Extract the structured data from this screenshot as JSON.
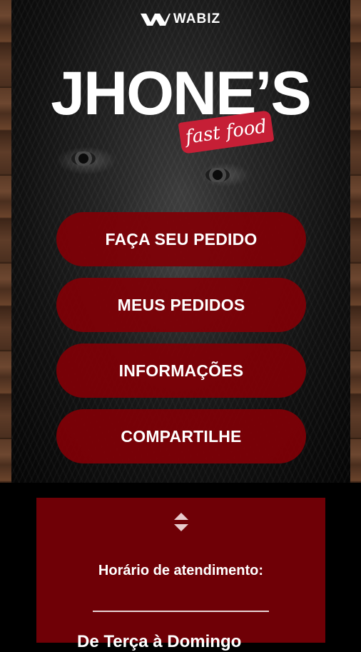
{
  "logo": {
    "text": "WABIZ",
    "icon": "wabiz-logo-icon"
  },
  "brand": {
    "title": "JHONE’S",
    "tagline": "fast food"
  },
  "menu": {
    "items": [
      {
        "label": "FAÇA SEU PEDIDO"
      },
      {
        "label": "MEUS PEDIDOS"
      },
      {
        "label": "INFORMAÇÕES"
      },
      {
        "label": "COMPARTILHE"
      }
    ]
  },
  "hours": {
    "toggle_icon": "sort-arrows-icon",
    "title": "Horário de atendimento:",
    "first_row": "De Terça à Domingo"
  },
  "colors": {
    "button_bg": "#800006",
    "panel_bg": "#6f0006",
    "tagline_bg": "#c61f36"
  }
}
